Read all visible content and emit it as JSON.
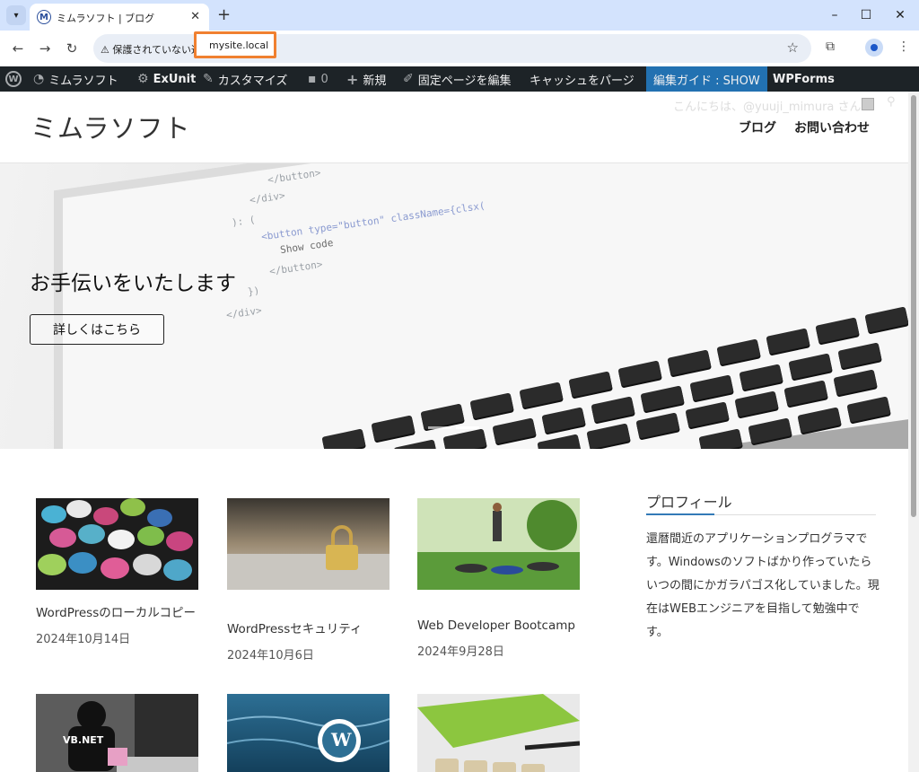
{
  "browser": {
    "tab_title": "ミムラソフト | ブログ",
    "tab_favicon_letter": "M",
    "security_label": "保護されていない通信",
    "url": "mysite.local"
  },
  "adminbar": {
    "site_name": "ミムラソフト",
    "exunit": "ExUnit",
    "customize": "カスタマイズ",
    "comments_count": "0",
    "new": "新規",
    "edit_page": "固定ページを編集",
    "purge_cache": "キャッシュをパージ",
    "edit_guide": "編集ガイド : SHOW",
    "wpforms": "WPForms"
  },
  "header": {
    "site_title": "ミムラソフト",
    "greeting": "こんにちは、@yuuji_mimura さん",
    "nav": [
      "ブログ",
      "お問い合わせ"
    ]
  },
  "hero": {
    "title": "お手伝いをいたします",
    "button": "詳しくはこちら",
    "code_lines": [
      "</button>",
      "</div>",
      "): (",
      "<button type=\"button\" className={clsx(",
      "Show code",
      "</button>",
      "})",
      "</div>"
    ],
    "slide_count": 2,
    "active_slide": 2
  },
  "posts": [
    {
      "title": "WordPressのローカルコピー",
      "date": "2024年10月14日",
      "thumb": "wordpress-buttons"
    },
    {
      "title": "WordPressセキュリティ",
      "date": "2024年10月6日",
      "thumb": "padlock-laptop"
    },
    {
      "title": "Web Developer Bootcamp",
      "date": "2024年9月28日",
      "thumb": "bootcamp-workout"
    },
    {
      "title": "",
      "date": "",
      "thumb": "vbnet-figure"
    },
    {
      "title": "",
      "date": "",
      "thumb": "wordpress-ocean"
    },
    {
      "title": "",
      "date": "",
      "thumb": "blog-blocks"
    }
  ],
  "sidebar": {
    "title": "プロフィール",
    "text": "還暦間近のアプリケーションプログラマです。Windowsのソフトばかり作っていたらいつの間にかガラパゴス化していました。現在はWEBエンジニアを目指して勉強中です。"
  },
  "colors": {
    "adminbar_bg": "#1d2327",
    "adminbar_highlight": "#2271b1",
    "url_highlight": "#f08030",
    "tabbar_bg": "#d3e3fd"
  }
}
